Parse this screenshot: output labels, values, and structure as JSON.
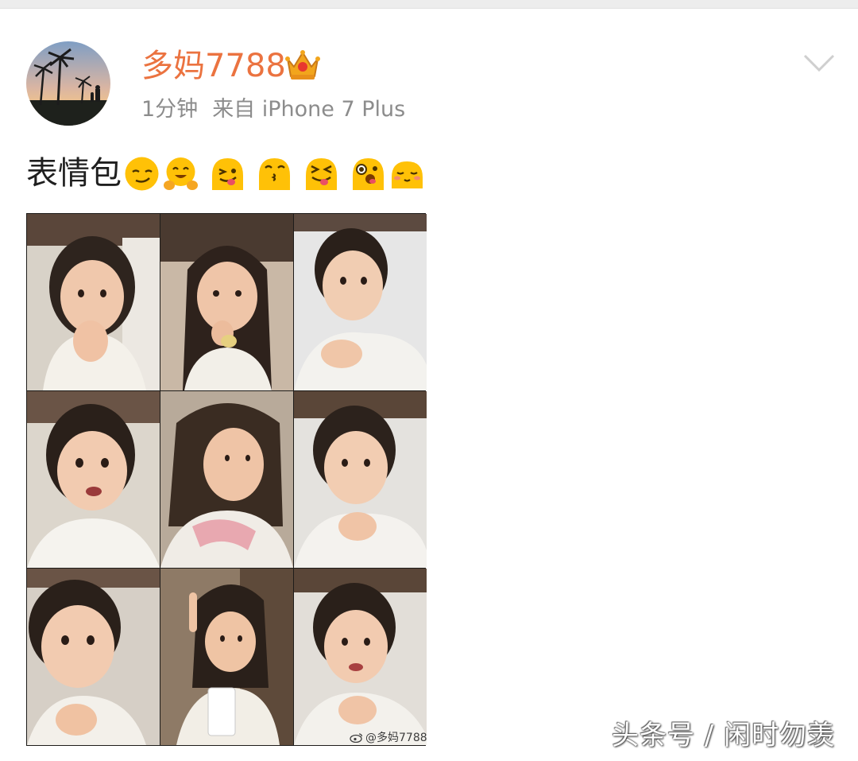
{
  "post": {
    "username": "多妈7788",
    "time": "1分钟",
    "source": "来自 iPhone 7 Plus",
    "text": "表情包",
    "emojis": [
      "smirk-emoji",
      "hug-emoji",
      "tongue-wink-emoji",
      "kiss-emoji",
      "squint-tongue-emoji",
      "surprised-tongue-emoji",
      "shy-emoji"
    ]
  },
  "photo": {
    "cells": 9,
    "watermark": "@多妈7788"
  },
  "footer": {
    "watermark": "头条号 / 闲时勿羡"
  },
  "colors": {
    "username": "#eb7340",
    "meta": "#8c8c8c",
    "emoji_yellow": "#ffc107",
    "chevron": "#cfcfcf"
  }
}
